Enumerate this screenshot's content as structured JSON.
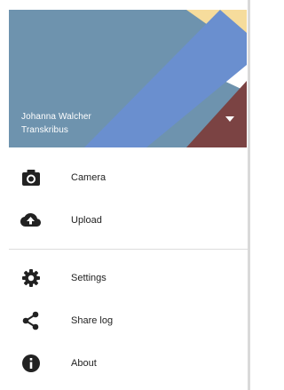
{
  "header": {
    "account_name": "Johanna Walcher",
    "account_org": "Transkribus",
    "colors": {
      "base": "#6e93ae",
      "blue_band": "#6a8fcf",
      "yellow": "#f6dc9c",
      "white_band": "#ffffff",
      "maroon": "#7b4343"
    }
  },
  "menu": {
    "primary": [
      {
        "label": "Camera",
        "icon": "camera-icon"
      },
      {
        "label": "Upload",
        "icon": "cloud-upload-icon"
      }
    ],
    "secondary": [
      {
        "label": "Settings",
        "icon": "gear-icon"
      },
      {
        "label": "Share log",
        "icon": "share-icon"
      },
      {
        "label": "About",
        "icon": "info-icon"
      }
    ]
  }
}
